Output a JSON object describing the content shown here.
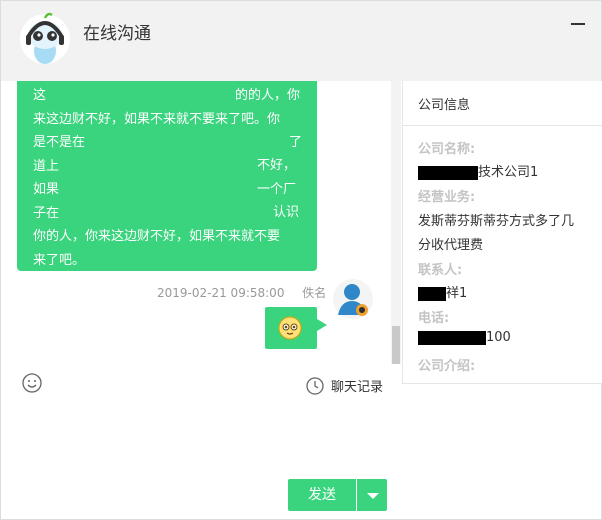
{
  "header": {
    "title": "在线沟通",
    "logo_icon": "mascot-logo-icon",
    "minimize_icon": "minimize-icon"
  },
  "chat": {
    "message_lines": [
      "这",
      "来这边财不好，如果不来就不要来了吧。你",
      "是不是在",
      "道上",
      "如果",
      "子在",
      "你的人，你来这边财不好，如果不来就不要",
      "来了吧。"
    ],
    "fragments": {
      "l1_right": "的的人，你",
      "l3_right": "了",
      "l4_right": "不好，",
      "l5_right": "一个厂",
      "l6_right": "认识"
    },
    "message_meta": {
      "time": "2019-02-21 09:58:00",
      "sender": "佚名"
    },
    "sent_emoji": "blushing-face-emoji",
    "avatar": "user-avatar-icon"
  },
  "panel": {
    "title": "公司信息",
    "company_label": "公司名称:",
    "company_value": "技术公司1",
    "business_label": "经营业务:",
    "business_value_1": "发斯蒂芬斯蒂芬方式多了几",
    "business_value_2": "分收代理费",
    "contact_label": "联系人:",
    "contact_value": "祥1",
    "phone_label": "电话:",
    "phone_value": "100",
    "intro_label": "公司介绍:"
  },
  "toolbar": {
    "emoji_icon": "smile-icon",
    "history_label": "聊天记录",
    "history_icon": "clock-icon"
  },
  "actions": {
    "send_label": "发送",
    "dropdown_icon": "chevron-down-icon"
  },
  "colors": {
    "accent": "#3bd47e",
    "header_bg": "#f2f2f2"
  }
}
